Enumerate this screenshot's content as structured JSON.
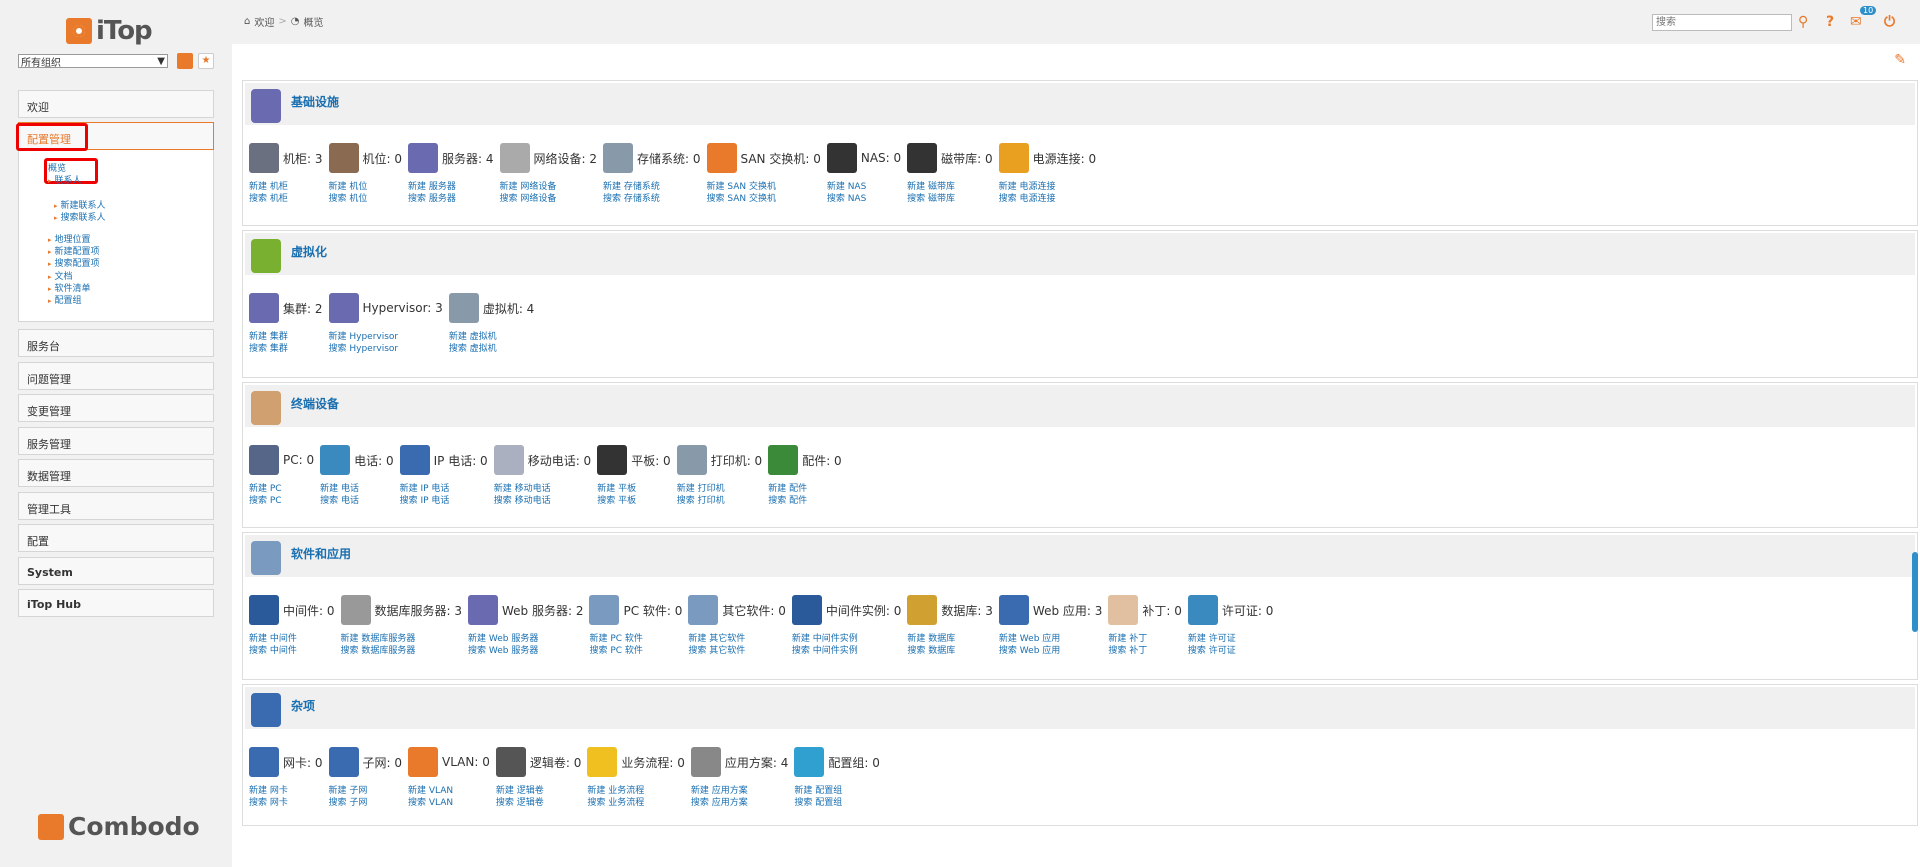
{
  "logo": "iTop",
  "org_select": "所有组织",
  "menus": [
    {
      "label": "欢迎",
      "active": false
    },
    {
      "label": "配置管理",
      "active": true
    },
    {
      "label": "服务台",
      "active": false
    },
    {
      "label": "问题管理",
      "active": false
    },
    {
      "label": "变更管理",
      "active": false
    },
    {
      "label": "服务管理",
      "active": false
    },
    {
      "label": "数据管理",
      "active": false
    },
    {
      "label": "管理工具",
      "active": false
    },
    {
      "label": "配置",
      "active": false
    },
    {
      "label": "System",
      "active": false
    },
    {
      "label": "iTop Hub",
      "active": false
    }
  ],
  "submenu": {
    "items": [
      "概览",
      "联系人",
      "新建联系人",
      "搜索联系人",
      "地理位置",
      "新建配置项",
      "搜索配置项",
      "文档",
      "软件清单",
      "配置组"
    ]
  },
  "footer_logo": "Combodo",
  "breadcrumb": [
    "欢迎",
    "概览"
  ],
  "search": {
    "placeholder": "搜索"
  },
  "notifications": {
    "count": "10"
  },
  "sections": [
    {
      "title": "基础设施",
      "items": [
        {
          "label": "机柜: 3",
          "new": "新建 机柜",
          "search": "搜索 机柜",
          "color": "#6a7080"
        },
        {
          "label": "机位: 0",
          "new": "新建 机位",
          "search": "搜索 机位",
          "color": "#8a6a50"
        },
        {
          "label": "服务器: 4",
          "new": "新建 服务器",
          "search": "搜索 服务器",
          "color": "#6a6ab0"
        },
        {
          "label": "网络设备: 2",
          "new": "新建 网络设备",
          "search": "搜索 网络设备",
          "color": "#aaaaaa"
        },
        {
          "label": "存储系统: 0",
          "new": "新建 存储系统",
          "search": "搜索 存储系统",
          "color": "#8899aa"
        },
        {
          "label": "SAN 交换机: 0",
          "new": "新建 SAN 交换机",
          "search": "搜索 SAN 交换机",
          "color": "#e9792b"
        },
        {
          "label": "NAS: 0",
          "new": "新建 NAS",
          "search": "搜索 NAS",
          "color": "#333333"
        },
        {
          "label": "磁带库: 0",
          "new": "新建 磁带库",
          "search": "搜索 磁带库",
          "color": "#333333"
        },
        {
          "label": "电源连接: 0",
          "new": "新建 电源连接",
          "search": "搜索 电源连接",
          "color": "#e9a020"
        }
      ]
    },
    {
      "title": "虚拟化",
      "items": [
        {
          "label": "集群: 2",
          "new": "新建 集群",
          "search": "搜索 集群",
          "color": "#6a6ab0"
        },
        {
          "label": "Hypervisor: 3",
          "new": "新建 Hypervisor",
          "search": "搜索 Hypervisor",
          "color": "#6a6ab0"
        },
        {
          "label": "虚拟机: 4",
          "new": "新建 虚拟机",
          "search": "搜索 虚拟机",
          "color": "#8899aa"
        }
      ]
    },
    {
      "title": "终端设备",
      "items": [
        {
          "label": "PC: 0",
          "new": "新建 PC",
          "search": "搜索 PC",
          "color": "#556688"
        },
        {
          "label": "电话: 0",
          "new": "新建 电话",
          "search": "搜索 电话",
          "color": "#3a8ac0"
        },
        {
          "label": "IP 电话: 0",
          "new": "新建 IP 电话",
          "search": "搜索 IP 电话",
          "color": "#3a6ab0"
        },
        {
          "label": "移动电话: 0",
          "new": "新建 移动电话",
          "search": "搜索 移动电话",
          "color": "#aab0c0"
        },
        {
          "label": "平板: 0",
          "new": "新建 平板",
          "search": "搜索 平板",
          "color": "#333333"
        },
        {
          "label": "打印机: 0",
          "new": "新建 打印机",
          "search": "搜索 打印机",
          "color": "#8899aa"
        },
        {
          "label": "配件: 0",
          "new": "新建 配件",
          "search": "搜索 配件",
          "color": "#3a8a3a"
        }
      ]
    },
    {
      "title": "软件和应用",
      "items": [
        {
          "label": "中间件: 0",
          "new": "新建 中间件",
          "search": "搜索 中间件",
          "color": "#2a5a9a"
        },
        {
          "label": "数据库服务器: 3",
          "new": "新建 数据库服务器",
          "search": "搜索 数据库服务器",
          "color": "#999999"
        },
        {
          "label": "Web 服务器: 2",
          "new": "新建 Web 服务器",
          "search": "搜索 Web 服务器",
          "color": "#6a6ab0"
        },
        {
          "label": "PC 软件: 0",
          "new": "新建 PC 软件",
          "search": "搜索 PC 软件",
          "color": "#7a9ac0"
        },
        {
          "label": "其它软件: 0",
          "new": "新建 其它软件",
          "search": "搜索 其它软件",
          "color": "#7a9ac0"
        },
        {
          "label": "中间件实例: 0",
          "new": "新建 中间件实例",
          "search": "搜索 中间件实例",
          "color": "#2a5a9a"
        },
        {
          "label": "数据库: 3",
          "new": "新建 数据库",
          "search": "搜索 数据库",
          "color": "#d0a030"
        },
        {
          "label": "Web 应用: 3",
          "new": "新建 Web 应用",
          "search": "搜索 Web 应用",
          "color": "#3a6ab0"
        },
        {
          "label": "补丁: 0",
          "new": "新建 补丁",
          "search": "搜索 补丁",
          "color": "#e0c0a0"
        },
        {
          "label": "许可证: 0",
          "new": "新建 许可证",
          "search": "搜索 许可证",
          "color": "#3a8ac0"
        }
      ]
    },
    {
      "title": "杂项",
      "items": [
        {
          "label": "网卡: 0",
          "new": "新建 网卡",
          "search": "搜索 网卡",
          "color": "#3a6ab0"
        },
        {
          "label": "子网: 0",
          "new": "新建 子网",
          "search": "搜索 子网",
          "color": "#3a6ab0"
        },
        {
          "label": "VLAN: 0",
          "new": "新建 VLAN",
          "search": "搜索 VLAN",
          "color": "#e9792b"
        },
        {
          "label": "逻辑卷: 0",
          "new": "新建 逻辑卷",
          "search": "搜索 逻辑卷",
          "color": "#555555"
        },
        {
          "label": "业务流程: 0",
          "new": "新建 业务流程",
          "search": "搜索 业务流程",
          "color": "#f0c020"
        },
        {
          "label": "应用方案: 4",
          "new": "新建 应用方案",
          "search": "搜索 应用方案",
          "color": "#888888"
        },
        {
          "label": "配置组: 0",
          "new": "新建 配置组",
          "search": "搜索 配置组",
          "color": "#30a0d0"
        }
      ]
    }
  ]
}
